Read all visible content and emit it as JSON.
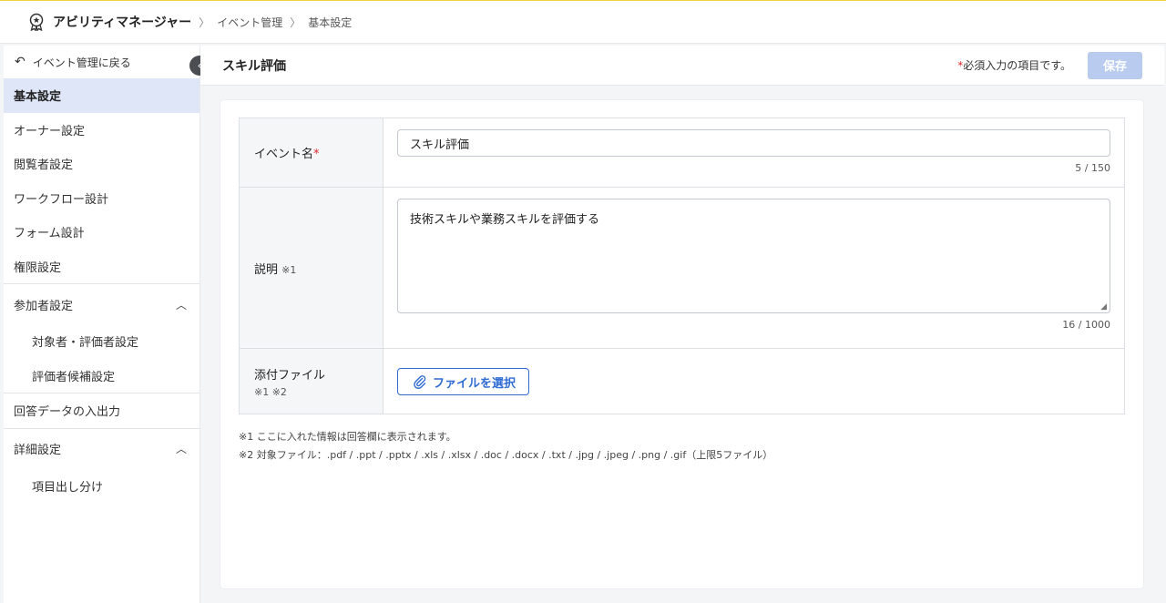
{
  "topbar": {
    "app_name": "アビリティマネージャー",
    "breadcrumb": [
      "イベント管理",
      "基本設定"
    ]
  },
  "sidebar": {
    "back_label": "イベント管理に戻る",
    "items": [
      {
        "label": "基本設定"
      },
      {
        "label": "オーナー設定"
      },
      {
        "label": "閲覧者設定"
      },
      {
        "label": "ワークフロー設計"
      },
      {
        "label": "フォーム設計"
      },
      {
        "label": "権限設定"
      }
    ],
    "participants": {
      "label": "参加者設定",
      "children": [
        "対象者・評価者設定",
        "評価者候補設定"
      ]
    },
    "io_label": "回答データの入出力",
    "details": {
      "label": "詳細設定",
      "children": [
        "項目出し分け"
      ]
    }
  },
  "header": {
    "title": "スキル評価",
    "required_note": "必須入力の項目です。",
    "save_label": "保存"
  },
  "form": {
    "event_name": {
      "label": "イベント名",
      "value": "スキル評価",
      "counter": "5 / 150"
    },
    "description": {
      "label": "説明",
      "note": "※1",
      "value": "技術スキルや業務スキルを評価する",
      "counter": "16 / 1000"
    },
    "attachment": {
      "label": "添付ファイル",
      "note": "※1 ※2",
      "button_label": "ファイルを選択"
    }
  },
  "footnotes": [
    "※1 ここに入れた情報は回答欄に表示されます。",
    "※2 対象ファイル：.pdf / .ppt / .pptx / .xls / .xlsx / .doc / .docx / .txt / .jpg / .jpeg / .png / .gif（上限5ファイル）"
  ],
  "colors": {
    "accent": "#2f6bd3",
    "active_bg": "#dee6f7",
    "required": "#d9262b",
    "save_disabled": "#b9ccef"
  }
}
